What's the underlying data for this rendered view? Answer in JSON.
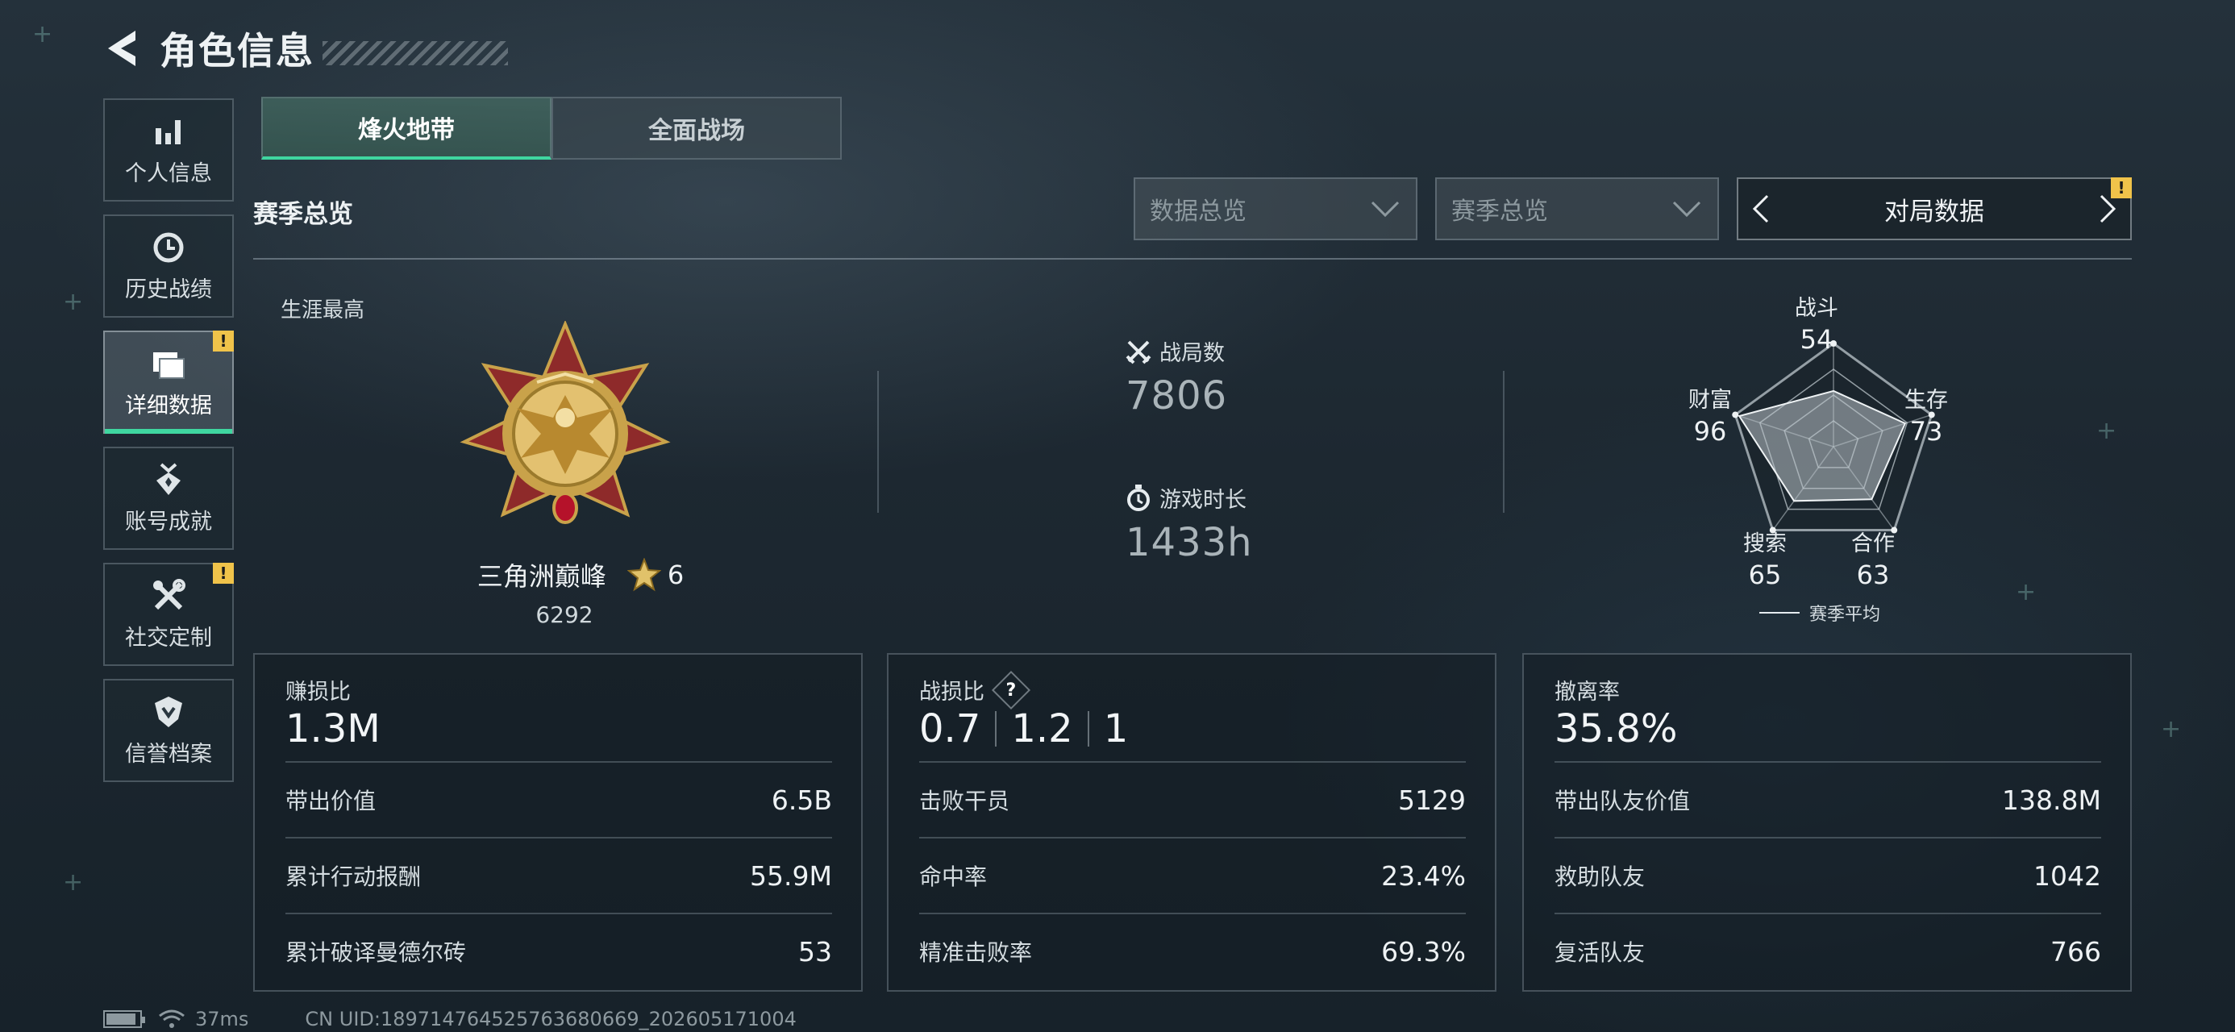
{
  "header": {
    "title": "角色信息",
    "back_icon": "back-arrow-icon"
  },
  "sidebar": {
    "items": [
      {
        "label": "个人信息",
        "icon": "bar-chart-icon",
        "active": false,
        "badge": ""
      },
      {
        "label": "历史战绩",
        "icon": "history-clock-icon",
        "active": false,
        "badge": ""
      },
      {
        "label": "详细数据",
        "icon": "folder-icon",
        "active": true,
        "badge": "!"
      },
      {
        "label": "账号成就",
        "icon": "achievement-medal-icon",
        "active": false,
        "badge": ""
      },
      {
        "label": "社交定制",
        "icon": "wrench-tools-icon",
        "active": false,
        "badge": "!"
      },
      {
        "label": "信誉档案",
        "icon": "credit-shield-icon",
        "active": false,
        "badge": ""
      }
    ]
  },
  "tabs": [
    {
      "label": "烽火地带",
      "active": true
    },
    {
      "label": "全面战场",
      "active": false
    }
  ],
  "section": {
    "title": "赛季总览"
  },
  "filters": {
    "data_select": {
      "value": "数据总览"
    },
    "season_select": {
      "value": "赛季总览"
    },
    "pager": {
      "label": "对局数据",
      "badge": "!"
    }
  },
  "career": {
    "label": "生涯最高",
    "rank_name": "三角洲巅峰",
    "stars": "6",
    "score": "6292"
  },
  "overview": {
    "matches_label": "战局数",
    "matches_value": "7806",
    "playtime_label": "游戏时长",
    "playtime_value": "1433h"
  },
  "radar": {
    "axes": [
      {
        "label": "战斗",
        "value": "54"
      },
      {
        "label": "生存",
        "value": "73"
      },
      {
        "label": "合作",
        "value": "63"
      },
      {
        "label": "搜索",
        "value": "65"
      },
      {
        "label": "财富",
        "value": "96"
      }
    ],
    "max": 100,
    "legend": "赛季平均"
  },
  "cards": {
    "profit": {
      "title": "赚损比",
      "value": "1.3M",
      "rows": [
        {
          "label": "带出价值",
          "value": "6.5B"
        },
        {
          "label": "累计行动报酬",
          "value": "55.9M"
        },
        {
          "label": "累计破译曼德尔砖",
          "value": "53"
        }
      ]
    },
    "kd": {
      "title": "战损比",
      "help": "?",
      "values": [
        "0.7",
        "1.2",
        "1"
      ],
      "rows": [
        {
          "label": "击败干员",
          "value": "5129"
        },
        {
          "label": "命中率",
          "value": "23.4%"
        },
        {
          "label": "精准击败率",
          "value": "69.3%"
        }
      ]
    },
    "extract": {
      "title": "撤离率",
      "value": "35.8%",
      "rows": [
        {
          "label": "带出队友价值",
          "value": "138.8M"
        },
        {
          "label": "救助队友",
          "value": "1042"
        },
        {
          "label": "复活队友",
          "value": "766"
        }
      ]
    }
  },
  "status": {
    "ping": "37ms",
    "uid": "CN UID:189714764525763680669_202605171004"
  },
  "colors": {
    "accent": "#3fd6a0",
    "badge": "#f0c34a"
  }
}
